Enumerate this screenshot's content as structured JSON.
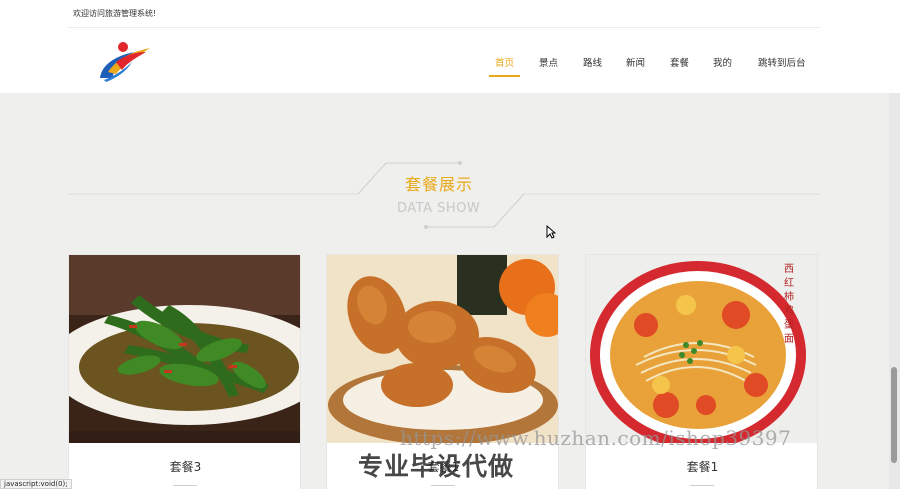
{
  "header": {
    "welcome_text": "欢迎访问旅游管理系统!",
    "nav": [
      {
        "label": "首页",
        "active": true
      },
      {
        "label": "景点",
        "active": false
      },
      {
        "label": "路线",
        "active": false
      },
      {
        "label": "新闻",
        "active": false
      },
      {
        "label": "套餐",
        "active": false
      },
      {
        "label": "我的",
        "active": false
      },
      {
        "label": "跳转到后台",
        "active": false
      }
    ]
  },
  "section": {
    "title": "套餐展示",
    "subtitle": "DATA SHOW"
  },
  "cards": [
    {
      "label": "套餐3",
      "image": "stir-fried-greens-image"
    },
    {
      "label": "套餐1",
      "image": "fried-chicken-image"
    },
    {
      "label": "套餐1",
      "image": "tomato-egg-noodles-image",
      "image_text": "西红柿鸡蛋面"
    }
  ],
  "status_bar": {
    "text": "javascript:void(0);"
  },
  "watermark": {
    "url": "https://www.huzhan.com/ishop39397",
    "text": "专业毕设代做"
  },
  "colors": {
    "accent": "#e9a91a",
    "background": "#efefed"
  }
}
